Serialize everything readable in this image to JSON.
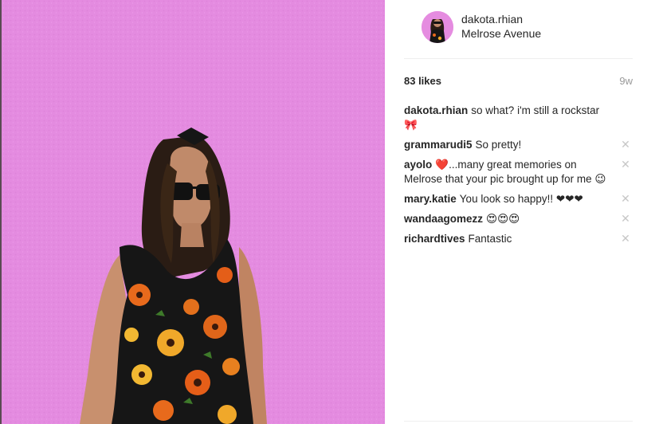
{
  "post": {
    "photo_icon": "photo-image",
    "background_color": "#e58ce0"
  },
  "header": {
    "username": "dakota.rhian",
    "location": "Melrose Avenue"
  },
  "stats": {
    "likes": "83 likes",
    "age": "9w"
  },
  "comments": [
    {
      "user": "dakota.rhian",
      "text": "so what? i'm still a rockstar 🎀",
      "deletable": false
    },
    {
      "user": "grammarudi5",
      "text": "So pretty!",
      "deletable": true
    },
    {
      "user": "ayolo",
      "text": "❤️...many great memories on Melrose that your pic brought up for me 😉",
      "deletable": true
    },
    {
      "user": "mary.katie",
      "text": "You look so happy!! ❤❤❤",
      "deletable": true
    },
    {
      "user": "wandaagomezz",
      "text": "😍😍😍",
      "deletable": true
    },
    {
      "user": "richardtives",
      "text": "Fantastic",
      "deletable": true
    }
  ],
  "delete_glyph": "✕"
}
